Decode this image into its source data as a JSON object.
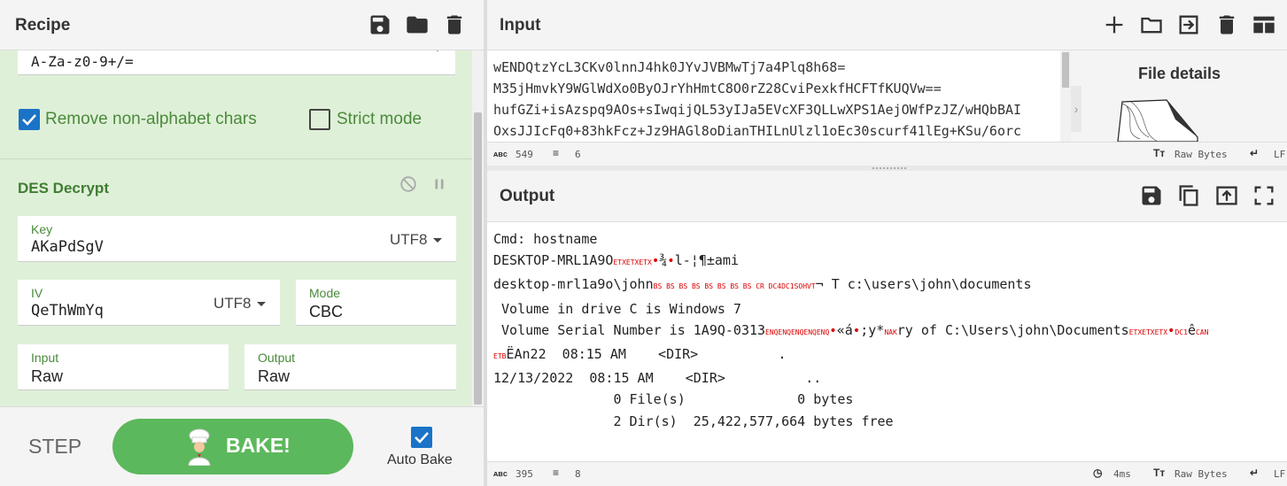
{
  "recipe": {
    "title": "Recipe",
    "header_icons": [
      "save-icon",
      "folder-icon",
      "trash-icon"
    ],
    "alphabet_value": "A-Za-z0-9+/=",
    "remove_non_alphabet_label": "Remove non-alphabet chars",
    "remove_non_alphabet_checked": true,
    "strict_mode_label": "Strict mode",
    "strict_mode_checked": false,
    "des": {
      "title": "DES Decrypt",
      "key_label": "Key",
      "key_value": "AKaPdSgV",
      "key_encoding": "UTF8",
      "iv_label": "IV",
      "iv_value": "QeThWmYq",
      "iv_encoding": "UTF8",
      "mode_label": "Mode",
      "mode_value": "CBC",
      "input_label": "Input",
      "input_value": "Raw",
      "output_label": "Output",
      "output_value": "Raw"
    },
    "footer": {
      "step_label": "STEP",
      "bake_label": "BAKE!",
      "autobake_label": "Auto Bake",
      "autobake_checked": true
    }
  },
  "input": {
    "title": "Input",
    "lines": [
      "wENDQtzYcL3CKv0lnnJ4hk0JYvJVBMwTj7a4Plq8h68=",
      "M35jHmvkY9WGlWdXo0ByOJrYhHmtC8O0rZ28CviPexkfHCFTfKUQVw==",
      "hufGZi+isAzspq9AOs+sIwqijQL53yIJa5EVcXF3QLLwXPS1AejOWfPzJZ/wHQbBAI",
      "OxsJJIcFq0+83hkFcz+Jz9HAGl8oDianTHILnUlzl1oEc30scurf41lEg+KSu/6orc"
    ],
    "file_details_title": "File details",
    "status": {
      "chars": "549",
      "lines": "6",
      "encoding": "Raw Bytes",
      "eol": "LF"
    }
  },
  "output": {
    "title": "Output",
    "line1": "Cmd: hostname",
    "line2_a": "DESKTOP-MRL1A9O",
    "line2_ctrl": "ETXETXETX",
    "line2_b": "¾",
    "line2_c": "l-¦¶±ami",
    "line3_a": "desktop-mrl1a9o\\john",
    "line3_ctrl": "BS BS BS BS BS BS BS BS CR DC4DC1SOHVT",
    "line3_b": "¬ T c:\\users\\john\\documents",
    "line4": " Volume in drive C is Windows 7",
    "line5_a": " Volume Serial Number is 1A9Q-0313",
    "line5_ctrl1": "ENQENQENQENQENQ",
    "line5_b": "«á",
    "line5_c": ";y*",
    "line5_ctrl2": "NAK",
    "line5_d": "ry of C:\\Users\\john\\Documents",
    "line5_ctrl3": "ETXETXETX",
    "line5_ctrl4": "DC1",
    "line5_e": "ê",
    "line5_ctrl5": "CAN",
    "line6_ctrl": "ETB",
    "line6_a": "ËAn22  08:15 AM    <DIR>          .",
    "line7": "12/13/2022  08:15 AM    <DIR>          ..",
    "line8": "               0 File(s)              0 bytes",
    "line9": "               2 Dir(s)  25,422,577,664 bytes free",
    "status": {
      "chars": "395",
      "lines": "8",
      "time": "4ms",
      "encoding": "Raw Bytes",
      "eol": "LF"
    }
  }
}
